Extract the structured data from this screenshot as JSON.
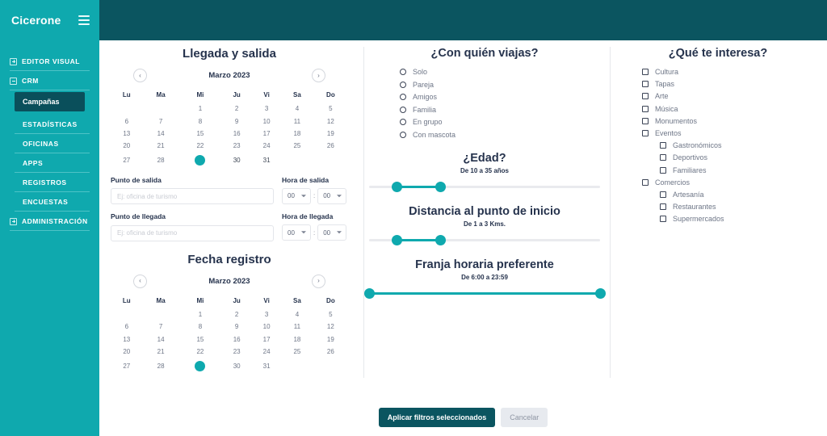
{
  "sidebar": {
    "brand": "Cicerone",
    "menu_icon": "hamburger-icon",
    "groups": [
      {
        "label": "EDITOR VISUAL",
        "state": "collapsed",
        "toggle": "+"
      },
      {
        "label": "CRM",
        "state": "expanded",
        "toggle": "-"
      }
    ],
    "crm_items": [
      {
        "label": "Campañas",
        "active": true
      },
      {
        "label": "ESTADÍSTICAS",
        "active": false
      },
      {
        "label": "OFICINAS",
        "active": false
      },
      {
        "label": "APPS",
        "active": false
      },
      {
        "label": "REGISTROS",
        "active": false
      },
      {
        "label": "ENCUESTAS",
        "active": false
      }
    ],
    "admin": {
      "label": "ADMINISTRACIÓN",
      "state": "collapsed",
      "toggle": "+"
    }
  },
  "colors": {
    "sidebar": "#0fa9ae",
    "header": "#0b5560",
    "accent": "#0fa9ae",
    "heading": "#26334d",
    "primary_button": "#0b5560"
  },
  "left": {
    "title": "Llegada y salida",
    "calendar_arrival": {
      "month": "Marzo 2023",
      "prev": "‹",
      "next": "›",
      "weekdays": [
        "Lu",
        "Ma",
        "Mi",
        "Ju",
        "Vi",
        "Sa",
        "Do"
      ],
      "weeks": [
        [
          "",
          "",
          "1",
          "2",
          "3",
          "4",
          "5"
        ],
        [
          "6",
          "7",
          "8",
          "9",
          "10",
          "11",
          "12"
        ],
        [
          "13",
          "14",
          "15",
          "16",
          "17",
          "18",
          "19"
        ],
        [
          "20",
          "21",
          "22",
          "23",
          "24",
          "25",
          "26"
        ],
        [
          "27",
          "28",
          "29",
          "30",
          "31",
          "",
          ""
        ]
      ],
      "selected_day": "29",
      "dark_days": [
        "29",
        "30",
        "31"
      ],
      "style": "muted"
    },
    "fields": {
      "departure_point_label": "Punto de salida",
      "departure_point_value": "",
      "departure_point_placeholder": "Ej: oficina de turismo",
      "departure_time_label": "Hora de salida",
      "departure_hour": "00",
      "departure_minute": "00",
      "arrival_point_label": "Punto de llegada",
      "arrival_point_value": "",
      "arrival_point_placeholder": "Ej: oficina de turismo",
      "arrival_time_label": "Hora de llegada",
      "arrival_hour": "00",
      "arrival_minute": "00",
      "time_separator": ":"
    },
    "title2": "Fecha registro",
    "calendar_register": {
      "month": "Marzo 2023",
      "prev": "‹",
      "next": "›",
      "weekdays": [
        "Lu",
        "Ma",
        "Mi",
        "Ju",
        "Vi",
        "Sa",
        "Do"
      ],
      "weeks": [
        [
          "",
          "",
          "1",
          "2",
          "3",
          "4",
          "5"
        ],
        [
          "6",
          "7",
          "8",
          "9",
          "10",
          "11",
          "12"
        ],
        [
          "13",
          "14",
          "15",
          "16",
          "17",
          "18",
          "19"
        ],
        [
          "20",
          "21",
          "22",
          "23",
          "24",
          "25",
          "26"
        ],
        [
          "27",
          "28",
          "29",
          "30",
          "31",
          "",
          ""
        ]
      ],
      "selected_day": "29",
      "style": "normal"
    }
  },
  "middle": {
    "travel_with_title": "¿Con quién viajas?",
    "travel_with_options": [
      {
        "label": "Solo",
        "checked": false
      },
      {
        "label": "Pareja",
        "checked": false
      },
      {
        "label": "Amigos",
        "checked": false
      },
      {
        "label": "Familia",
        "checked": false
      },
      {
        "label": "En grupo",
        "checked": false
      },
      {
        "label": "Con mascota",
        "checked": false
      }
    ],
    "age": {
      "title": "¿Edad?",
      "subtitle": "De 10 a 35 años",
      "min_value": 10,
      "max_value": 35,
      "left_pct": 12,
      "right_pct": 31
    },
    "distance": {
      "title": "Distancia al punto de inicio",
      "subtitle": "De 1 a 3 Kms.",
      "min_value": 1,
      "max_value": 3,
      "left_pct": 12,
      "right_pct": 31
    },
    "timeband": {
      "title": "Franja horaria preferente",
      "subtitle": "De 6:00 a 23:59",
      "min_value": "6:00",
      "max_value": "23:59",
      "left_pct": 0,
      "right_pct": 100
    }
  },
  "right": {
    "title": "¿Qué te interesa?",
    "options": [
      {
        "label": "Cultura",
        "checked": false,
        "indent": false
      },
      {
        "label": "Tapas",
        "checked": false,
        "indent": false
      },
      {
        "label": "Arte",
        "checked": false,
        "indent": false
      },
      {
        "label": "Música",
        "checked": false,
        "indent": false
      },
      {
        "label": "Monumentos",
        "checked": false,
        "indent": false
      },
      {
        "label": "Eventos",
        "checked": false,
        "indent": false
      },
      {
        "label": "Gastronómicos",
        "checked": false,
        "indent": true
      },
      {
        "label": "Deportivos",
        "checked": false,
        "indent": true
      },
      {
        "label": "Familiares",
        "checked": false,
        "indent": true
      },
      {
        "label": "Comercios",
        "checked": false,
        "indent": false
      },
      {
        "label": "Artesanía",
        "checked": false,
        "indent": true
      },
      {
        "label": "Restaurantes",
        "checked": false,
        "indent": true
      },
      {
        "label": "Supermercados",
        "checked": false,
        "indent": true
      }
    ]
  },
  "footer": {
    "apply_label": "Aplicar filtros seleccionados",
    "cancel_label": "Cancelar"
  }
}
